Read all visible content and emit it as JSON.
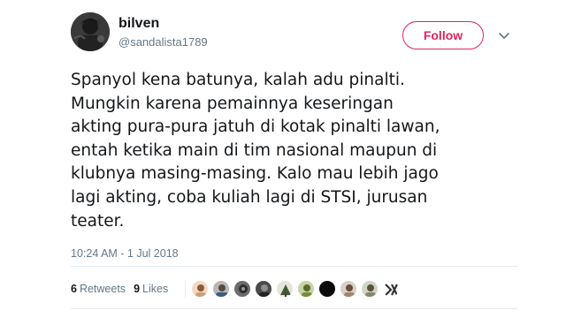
{
  "user": {
    "display_name": "bilven",
    "username": "@sandalista1789"
  },
  "follow_label": "Follow",
  "tweet": {
    "lines": [
      "Spanyol kena batunya, kalah adu pinalti.",
      "Mungkin karena pemainnya keseringan",
      "akting pura-pura jatuh di kotak pinalti lawan,",
      "entah ketika main di tim nasional maupun di",
      "klubnya masing-masing. Kalo mau lebih jago",
      "lagi akting, coba kuliah lagi di STSI, jurusan",
      "teater."
    ],
    "timestamp": "10:24 AM - 1 Jul 2018"
  },
  "stats": {
    "retweets_count": "6",
    "retweets_label": "Retweets",
    "likes_count": "9",
    "likes_label": "Likes"
  },
  "colors": {
    "follow_accent": "#e0245e",
    "secondary_text": "#657786",
    "divider": "#e6ecf0"
  },
  "icons": {
    "menu": "chevron-down-icon"
  }
}
